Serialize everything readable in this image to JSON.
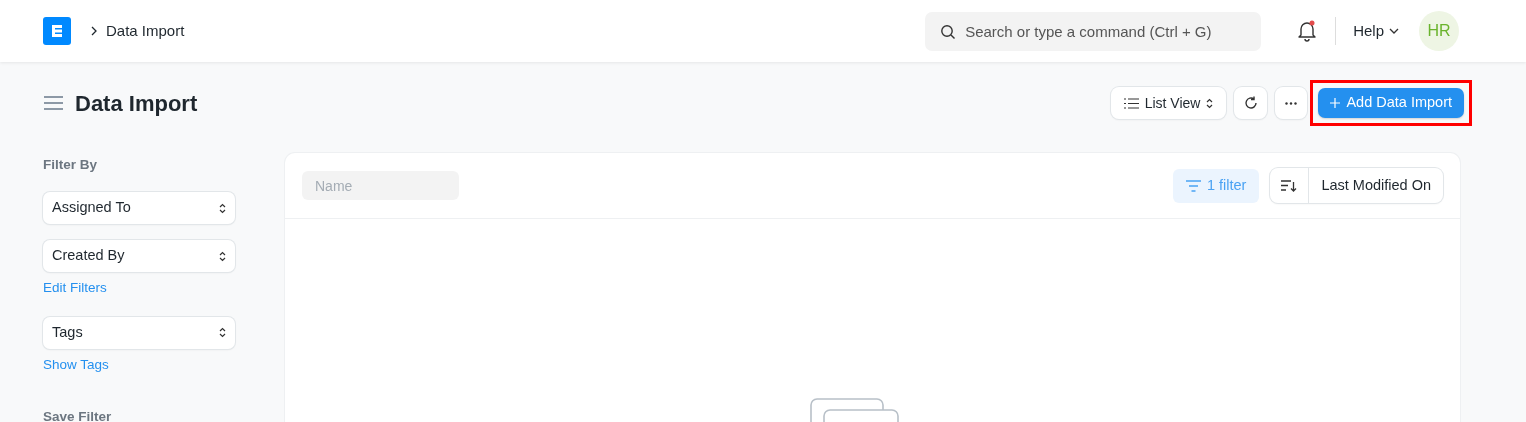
{
  "breadcrumb": {
    "current": "Data Import"
  },
  "search": {
    "placeholder": "Search or type a command (Ctrl + G)"
  },
  "notifications": {
    "unread": true
  },
  "help_menu": {
    "label": "Help"
  },
  "avatar": {
    "initials": "HR"
  },
  "page_title": "Data Import",
  "toolbar": {
    "view_switcher": "List View",
    "primary_button": "Add Data Import",
    "primary_highlighted": true
  },
  "sidebar": {
    "heading": "Filter By",
    "items": [
      {
        "kind": "select",
        "label": "Assigned To"
      },
      {
        "kind": "select",
        "label": "Created By"
      },
      {
        "kind": "link",
        "label": "Edit Filters"
      },
      {
        "kind": "select",
        "label": "Tags"
      },
      {
        "kind": "link",
        "label": "Show Tags"
      },
      {
        "kind": "heading",
        "label": "Save Filter"
      }
    ]
  },
  "list": {
    "name_filter": {
      "placeholder": "Name"
    },
    "filter_button": "1 filter",
    "sort": {
      "label": "Last Modified On"
    }
  }
}
